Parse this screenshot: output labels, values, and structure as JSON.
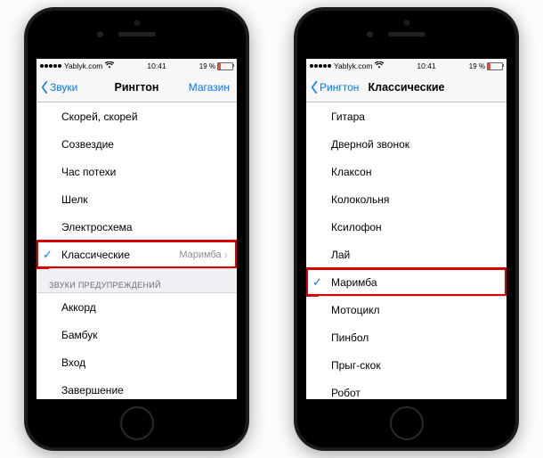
{
  "status": {
    "carrier": "Yablyk.com",
    "time": "10:41",
    "battery": "19 %"
  },
  "left_phone": {
    "nav": {
      "back": "Звуки",
      "title": "Рингтон",
      "right": "Магазин"
    },
    "rows": [
      {
        "label": "Скорей, скорей"
      },
      {
        "label": "Созвездие"
      },
      {
        "label": "Час потехи"
      },
      {
        "label": "Шелк"
      },
      {
        "label": "Электросхема"
      },
      {
        "label": "Классические",
        "checked": true,
        "detail": "Маримба",
        "disclosure": true,
        "highlight": true
      }
    ],
    "section_header": "ЗВУКИ ПРЕДУПРЕЖДЕНИЙ",
    "rows2": [
      {
        "label": "Аккорд"
      },
      {
        "label": "Бамбук"
      },
      {
        "label": "Вход"
      },
      {
        "label": "Завершение"
      }
    ]
  },
  "right_phone": {
    "nav": {
      "back": "Рингтон",
      "title": "Классические"
    },
    "rows": [
      {
        "label": "Гитара"
      },
      {
        "label": "Дверной звонок"
      },
      {
        "label": "Клаксон"
      },
      {
        "label": "Колокольня"
      },
      {
        "label": "Ксилофон"
      },
      {
        "label": "Лай"
      },
      {
        "label": "Маримба",
        "checked": true,
        "highlight": true
      },
      {
        "label": "Мотоцикл"
      },
      {
        "label": "Пинбол"
      },
      {
        "label": "Прыг-скок"
      },
      {
        "label": "Робот"
      }
    ]
  }
}
